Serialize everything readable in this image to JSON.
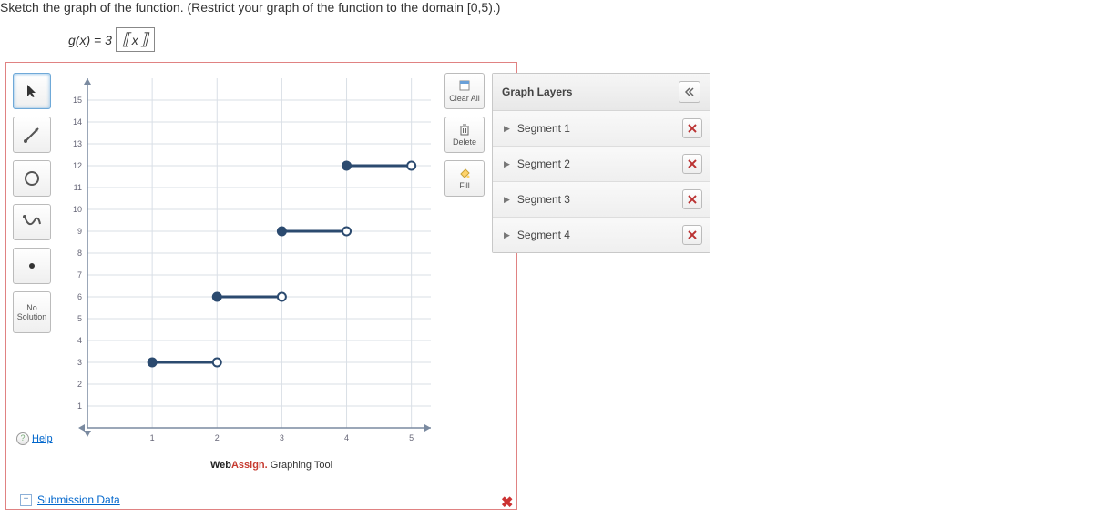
{
  "prompt": "Sketch the graph of the function. (Restrict your graph of the function to the domain [0,5).)",
  "formula": {
    "lhs": "g(x) = 3",
    "var": "x"
  },
  "tools": {
    "pointer": "pointer",
    "segment": "segment",
    "circle": "circle",
    "curve": "curve",
    "dot": "dot",
    "no_solution": "No\nSolution"
  },
  "side": {
    "clear": "Clear All",
    "delete": "Delete",
    "fill": "Fill"
  },
  "panel": {
    "title": "Graph Layers",
    "items": [
      "Segment 1",
      "Segment 2",
      "Segment 3",
      "Segment 4"
    ]
  },
  "help": "Help",
  "footer": {
    "brand": "Web",
    "brand2": "Assign.",
    "tail": " Graphing Tool"
  },
  "submission": "Submission Data",
  "chart_data": {
    "type": "step-segments",
    "xlabel": "",
    "ylabel": "",
    "xrange": [
      0,
      5.3
    ],
    "yrange": [
      0,
      16
    ],
    "xticks": [
      1,
      2,
      3,
      4,
      5
    ],
    "yticks": [
      1,
      2,
      3,
      4,
      5,
      6,
      7,
      8,
      9,
      10,
      11,
      12,
      13,
      14,
      15
    ],
    "segments": [
      {
        "x1": 1,
        "y1": 3,
        "x2": 2,
        "y2": 3,
        "left": "closed",
        "right": "open"
      },
      {
        "x1": 2,
        "y1": 6,
        "x2": 3,
        "y2": 6,
        "left": "closed",
        "right": "open"
      },
      {
        "x1": 3,
        "y1": 9,
        "x2": 4,
        "y2": 9,
        "left": "closed",
        "right": "open"
      },
      {
        "x1": 4,
        "y1": 12,
        "x2": 5,
        "y2": 12,
        "left": "closed",
        "right": "open"
      }
    ]
  }
}
